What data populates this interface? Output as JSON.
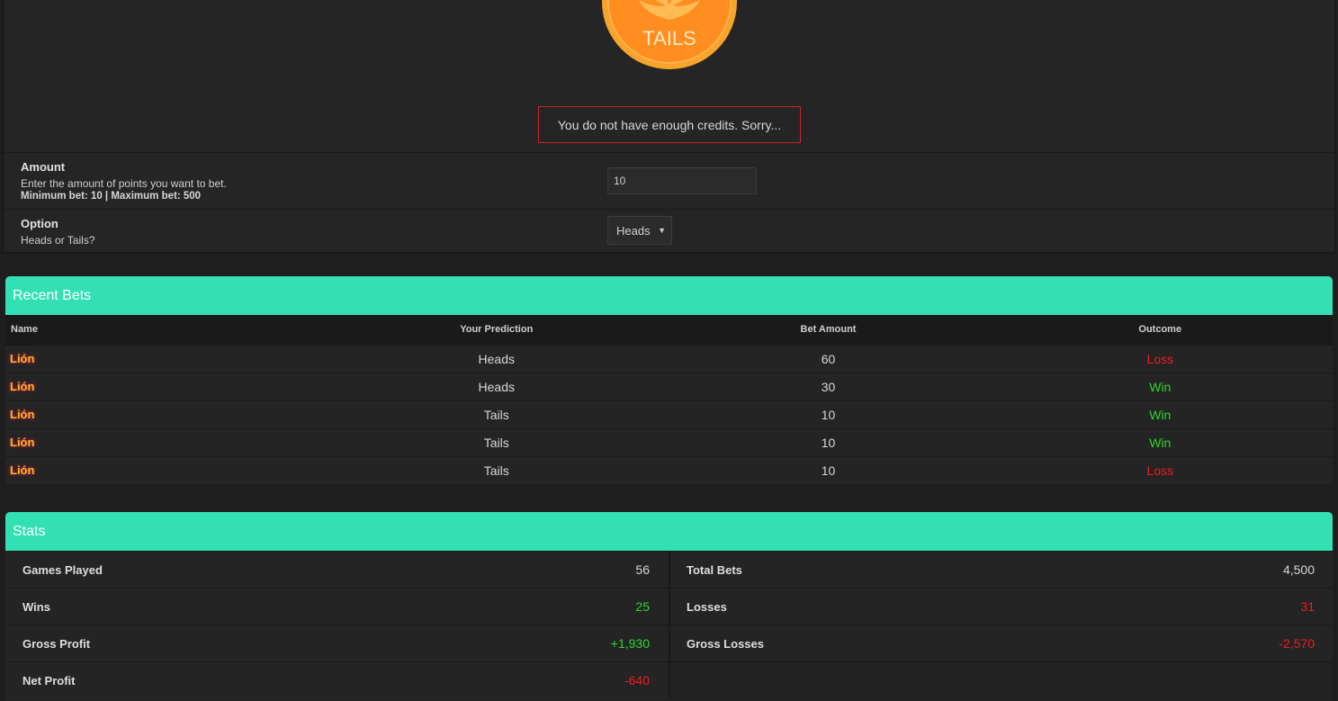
{
  "coin": {
    "label": "TAILS",
    "colors": {
      "outer": "#f5a025",
      "inner": "#ff8c1f",
      "text": "#ffe9c4"
    }
  },
  "alert": {
    "message": "You do not have enough credits. Sorry..."
  },
  "form": {
    "amount": {
      "label": "Amount",
      "description": "Enter the amount of points you want to bet.",
      "limits": "Minimum bet: 10 | Maximum bet: 500",
      "value": "10"
    },
    "option": {
      "label": "Option",
      "description": "Heads or Tails?",
      "selected": "Heads"
    }
  },
  "recent_bets": {
    "title": "Recent Bets",
    "columns": [
      "Name",
      "Your Prediction",
      "Bet Amount",
      "Outcome"
    ],
    "rows": [
      {
        "name": "Lión",
        "prediction": "Heads",
        "amount": "60",
        "outcome": "Loss"
      },
      {
        "name": "Lión",
        "prediction": "Heads",
        "amount": "30",
        "outcome": "Win"
      },
      {
        "name": "Lión",
        "prediction": "Tails",
        "amount": "10",
        "outcome": "Win"
      },
      {
        "name": "Lión",
        "prediction": "Tails",
        "amount": "10",
        "outcome": "Win"
      },
      {
        "name": "Lión",
        "prediction": "Tails",
        "amount": "10",
        "outcome": "Loss"
      }
    ]
  },
  "stats": {
    "title": "Stats",
    "left": [
      {
        "label": "Games Played",
        "value": "56",
        "tone": "neutral"
      },
      {
        "label": "Wins",
        "value": "25",
        "tone": "win"
      },
      {
        "label": "Gross Profit",
        "value": "+1,930",
        "tone": "win"
      },
      {
        "label": "Net Profit",
        "value": "-640",
        "tone": "loss"
      }
    ],
    "right": [
      {
        "label": "Total Bets",
        "value": "4,500",
        "tone": "neutral"
      },
      {
        "label": "Losses",
        "value": "31",
        "tone": "loss"
      },
      {
        "label": "Gross Losses",
        "value": "-2,570",
        "tone": "loss"
      }
    ]
  },
  "theme": {
    "accent": "#33e0b4",
    "win": "#2ed52e",
    "loss": "#ee1c1c",
    "name_color": "#f6b71b"
  }
}
